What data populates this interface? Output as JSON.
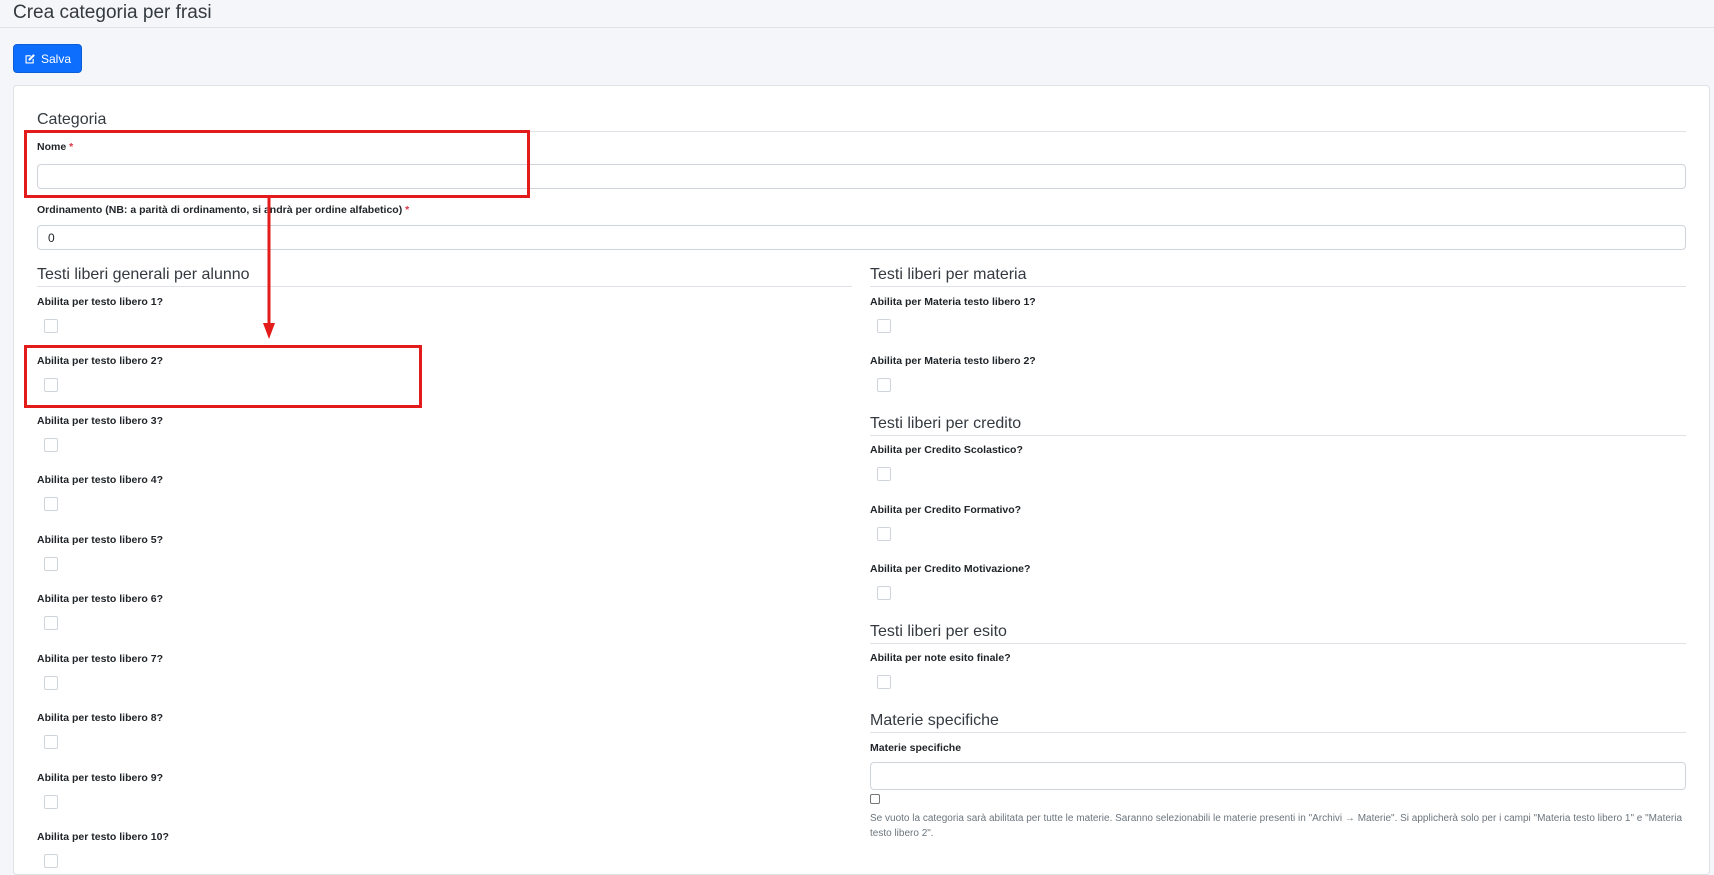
{
  "page": {
    "title": "Crea categoria per frasi"
  },
  "toolbar": {
    "save_label": "Salva",
    "save_icon": "edit-icon"
  },
  "category_section": {
    "title": "Categoria",
    "name_label": "Nome",
    "name_value": "",
    "order_label": "Ordinamento (NB: a parità di ordinamento, si andrà per ordine alfabetico)",
    "order_value": "0",
    "required_mark": "*"
  },
  "general_texts": {
    "title": "Testi liberi generali per alunno",
    "items": [
      {
        "label": "Abilita per testo libero 1?",
        "checked": false
      },
      {
        "label": "Abilita per testo libero 2?",
        "checked": false
      },
      {
        "label": "Abilita per testo libero 3?",
        "checked": false
      },
      {
        "label": "Abilita per testo libero 4?",
        "checked": false
      },
      {
        "label": "Abilita per testo libero 5?",
        "checked": false
      },
      {
        "label": "Abilita per testo libero 6?",
        "checked": false
      },
      {
        "label": "Abilita per testo libero 7?",
        "checked": false
      },
      {
        "label": "Abilita per testo libero 8?",
        "checked": false
      },
      {
        "label": "Abilita per testo libero 9?",
        "checked": false
      },
      {
        "label": "Abilita per testo libero 10?",
        "checked": false
      }
    ]
  },
  "subject_texts": {
    "title": "Testi liberi per materia",
    "items": [
      {
        "label": "Abilita per Materia testo libero 1?",
        "checked": false
      },
      {
        "label": "Abilita per Materia testo libero 2?",
        "checked": false
      }
    ]
  },
  "credit_texts": {
    "title": "Testi liberi per credito",
    "items": [
      {
        "label": "Abilita per Credito Scolastico?",
        "checked": false
      },
      {
        "label": "Abilita per Credito Formativo?",
        "checked": false
      },
      {
        "label": "Abilita per Credito Motivazione?",
        "checked": false
      }
    ]
  },
  "outcome_texts": {
    "title": "Testi liberi per esito",
    "items": [
      {
        "label": "Abilita per note esito finale?",
        "checked": false
      }
    ]
  },
  "specific_subjects": {
    "title": "Materie specifiche",
    "field_label": "Materie specifiche",
    "field_value": "",
    "all_subjects_checked": false,
    "help_text": "Se vuoto la categoria sarà abilitata per tutte le materie. Saranno selezionabili le materie presenti in \"Archivi → Materie\". Si applicherà solo per i campi \"Materia testo libero 1\" e \"Materia testo libero 2\"."
  },
  "colors": {
    "primary": "#0d6efd",
    "annotation": "#e41b1b",
    "required": "#dc3545"
  }
}
